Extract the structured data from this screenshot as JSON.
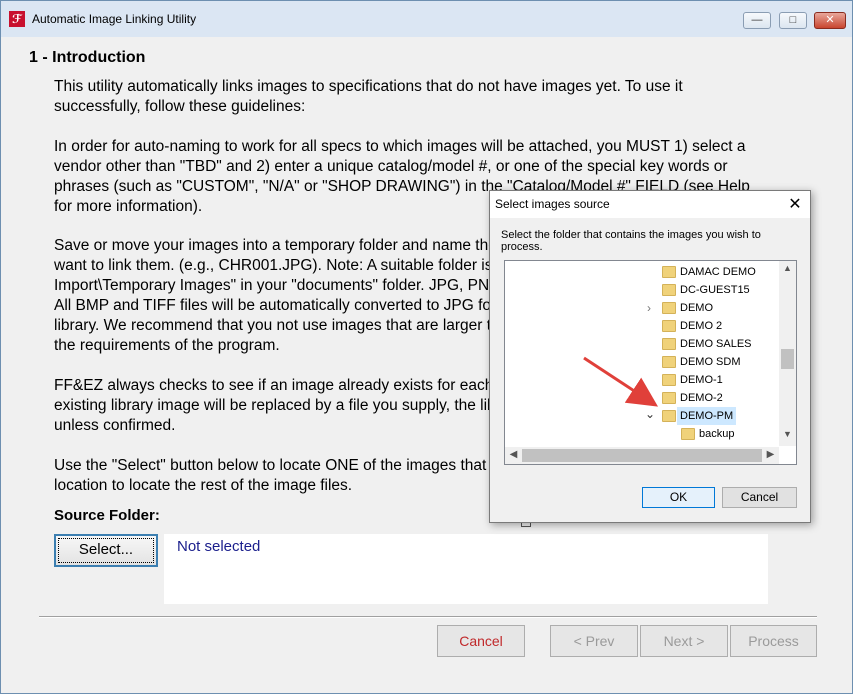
{
  "window": {
    "title": "Automatic Image Linking Utility",
    "controls": {
      "minimize": "—",
      "maximize": "□",
      "close": "✕"
    }
  },
  "intro": {
    "heading": "1 - Introduction",
    "para1": "This utility automatically links images to specifications that do not have images yet. To use it successfully, follow these guidelines:",
    "para2": "In order for auto-naming to work for all specs to which images will be attached, you MUST 1) select a vendor other than \"TBD\" and 2) enter a unique catalog/model #, or one of the special key words or phrases (such as \"CUSTOM\", \"N/A\" or \"SHOP DRAWING\") in the \"Catalog/Model #\" FIELD (see Help for more information).",
    "para3": "Save or move your images into a temporary folder and name them exactly as the spec number you want to link them. (e.g., CHR001.JPG). Note: A suitable folder is set up under \"FF&EZ-Import\\Temporary Images\" in your \"documents\" folder. JPG, PNG and GIF files are ideal for this use.  All BMP and TIFF files will be automatically converted to JPG format when they are saved to the library. We recommend that you not use images that are larger than 6 megs since these far exceed the requirements of the program.",
    "para4": "FF&EZ always checks to see if an image already exists for each spec before linking an image. If an existing library image will be replaced by a file you supply, the library image will not be replaced unless confirmed.",
    "para5": "Use the \"Select\" button below to locate ONE of the images that you want to link. FF&EZ will use its location to locate the rest of the image files."
  },
  "source": {
    "label": "Source Folder:",
    "select_button": "Select...",
    "value": "Not selected"
  },
  "nav": {
    "cancel": "Cancel",
    "prev": "< Prev",
    "next": "Next >",
    "process": "Process"
  },
  "dialog": {
    "title": "Select images source",
    "close": "✕",
    "instruction": "Select the folder that contains the images you wish to process.",
    "folders": [
      "DAMAC DEMO",
      "DC-GUEST15",
      "DEMO",
      "DEMO 2",
      "DEMO SALES",
      "DEMO SDM",
      "DEMO-1",
      "DEMO-2",
      "DEMO-PM",
      "backup"
    ],
    "selected_folder": "DEMO-PM",
    "ok": "OK",
    "cancel": "Cancel"
  },
  "colors": {
    "accent": "#0078d7",
    "cancel_text": "#c0282a",
    "not_selected_text": "#1a1e8c",
    "arrow": "#e0403a"
  }
}
